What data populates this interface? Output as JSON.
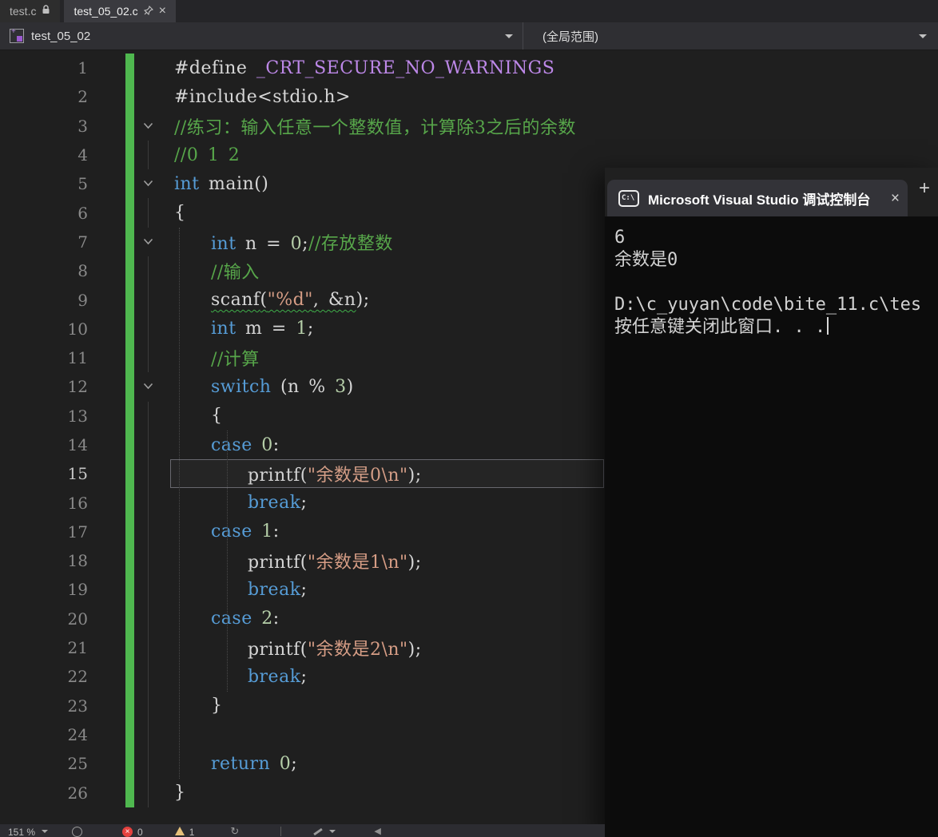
{
  "tabbar": {
    "tabs": [
      {
        "label": "test.c"
      },
      {
        "label": "test_05_02.c"
      }
    ],
    "close_glyph": "×"
  },
  "navbar": {
    "file": "test_05_02",
    "scope": "(全局范围)"
  },
  "editor": {
    "lines": [
      {
        "num": 1,
        "fold": "",
        "tokens": [
          {
            "t": "#define ",
            "c": "pp"
          },
          {
            "t": "_CRT_SECURE_NO_WARNINGS",
            "c": "macro"
          }
        ]
      },
      {
        "num": 2,
        "fold": "",
        "tokens": [
          {
            "t": "#include",
            "c": "pp"
          },
          {
            "t": "<stdio.h>",
            "c": "plain"
          }
        ]
      },
      {
        "num": 3,
        "fold": "v",
        "tokens": [
          {
            "t": "//练习：输入任意一个整数值，计算除3之后的余数",
            "c": "com"
          }
        ]
      },
      {
        "num": 4,
        "fold": "g",
        "tokens": [
          {
            "t": "//0 1 2",
            "c": "com"
          }
        ]
      },
      {
        "num": 5,
        "fold": "v",
        "tokens": [
          {
            "t": "int",
            "c": "kw"
          },
          {
            "t": " main()",
            "c": "plain"
          }
        ]
      },
      {
        "num": 6,
        "fold": "g",
        "tokens": [
          {
            "t": "{",
            "c": "plain"
          }
        ]
      },
      {
        "num": 7,
        "fold": "v",
        "tokens": [
          {
            "t": "    ",
            "c": "plain"
          },
          {
            "t": "int",
            "c": "kw"
          },
          {
            "t": " n = ",
            "c": "plain"
          },
          {
            "t": "0",
            "c": "num"
          },
          {
            "t": ";",
            "c": "plain"
          },
          {
            "t": "//存放整数",
            "c": "com"
          }
        ]
      },
      {
        "num": 8,
        "fold": "g",
        "tokens": [
          {
            "t": "    ",
            "c": "plain"
          },
          {
            "t": "//输入",
            "c": "com"
          }
        ]
      },
      {
        "num": 9,
        "fold": "g",
        "tokens": [
          {
            "t": "    ",
            "c": "plain"
          },
          {
            "t": "scanf",
            "c": "plain sq"
          },
          {
            "t": "(",
            "c": "plain sq"
          },
          {
            "t": "\"%d\"",
            "c": "str sq"
          },
          {
            "t": ", &n",
            "c": "plain sq"
          },
          {
            "t": ");",
            "c": "plain"
          }
        ]
      },
      {
        "num": 10,
        "fold": "g",
        "tokens": [
          {
            "t": "    ",
            "c": "plain"
          },
          {
            "t": "int",
            "c": "kw"
          },
          {
            "t": " m = ",
            "c": "plain"
          },
          {
            "t": "1",
            "c": "num"
          },
          {
            "t": ";",
            "c": "plain"
          }
        ]
      },
      {
        "num": 11,
        "fold": "g",
        "tokens": [
          {
            "t": "    ",
            "c": "plain"
          },
          {
            "t": "//计算",
            "c": "com"
          }
        ]
      },
      {
        "num": 12,
        "fold": "v",
        "tokens": [
          {
            "t": "    ",
            "c": "plain"
          },
          {
            "t": "switch",
            "c": "kw"
          },
          {
            "t": " (n % ",
            "c": "plain"
          },
          {
            "t": "3",
            "c": "num"
          },
          {
            "t": ")",
            "c": "plain"
          }
        ]
      },
      {
        "num": 13,
        "fold": "g",
        "tokens": [
          {
            "t": "    {",
            "c": "plain"
          }
        ]
      },
      {
        "num": 14,
        "fold": "g",
        "tokens": [
          {
            "t": "    ",
            "c": "plain"
          },
          {
            "t": "case",
            "c": "kw"
          },
          {
            "t": " ",
            "c": "plain"
          },
          {
            "t": "0",
            "c": "num"
          },
          {
            "t": ":",
            "c": "plain"
          }
        ]
      },
      {
        "num": 15,
        "fold": "g",
        "hl": true,
        "tokens": [
          {
            "t": "        printf(",
            "c": "plain"
          },
          {
            "t": "\"余数是0\\n\"",
            "c": "str"
          },
          {
            "t": ");",
            "c": "plain"
          }
        ]
      },
      {
        "num": 16,
        "fold": "g",
        "tokens": [
          {
            "t": "        ",
            "c": "plain"
          },
          {
            "t": "break",
            "c": "kw"
          },
          {
            "t": ";",
            "c": "plain"
          }
        ]
      },
      {
        "num": 17,
        "fold": "g",
        "tokens": [
          {
            "t": "    ",
            "c": "plain"
          },
          {
            "t": "case",
            "c": "kw"
          },
          {
            "t": " ",
            "c": "plain"
          },
          {
            "t": "1",
            "c": "num"
          },
          {
            "t": ":",
            "c": "plain"
          }
        ]
      },
      {
        "num": 18,
        "fold": "g",
        "tokens": [
          {
            "t": "        printf(",
            "c": "plain"
          },
          {
            "t": "\"余数是1\\n\"",
            "c": "str"
          },
          {
            "t": ");",
            "c": "plain"
          }
        ]
      },
      {
        "num": 19,
        "fold": "g",
        "tokens": [
          {
            "t": "        ",
            "c": "plain"
          },
          {
            "t": "break",
            "c": "kw"
          },
          {
            "t": ";",
            "c": "plain"
          }
        ]
      },
      {
        "num": 20,
        "fold": "g",
        "tokens": [
          {
            "t": "    ",
            "c": "plain"
          },
          {
            "t": "case",
            "c": "kw"
          },
          {
            "t": " ",
            "c": "plain"
          },
          {
            "t": "2",
            "c": "num"
          },
          {
            "t": ":",
            "c": "plain"
          }
        ]
      },
      {
        "num": 21,
        "fold": "g",
        "tokens": [
          {
            "t": "        printf(",
            "c": "plain"
          },
          {
            "t": "\"余数是2\\n\"",
            "c": "str"
          },
          {
            "t": ");",
            "c": "plain"
          }
        ]
      },
      {
        "num": 22,
        "fold": "g",
        "tokens": [
          {
            "t": "        ",
            "c": "plain"
          },
          {
            "t": "break",
            "c": "kw"
          },
          {
            "t": ";",
            "c": "plain"
          }
        ]
      },
      {
        "num": 23,
        "fold": "g",
        "tokens": [
          {
            "t": "    }",
            "c": "plain"
          }
        ]
      },
      {
        "num": 24,
        "fold": "g",
        "tokens": []
      },
      {
        "num": 25,
        "fold": "g",
        "tokens": [
          {
            "t": "    ",
            "c": "plain"
          },
          {
            "t": "return",
            "c": "kw"
          },
          {
            "t": " ",
            "c": "plain"
          },
          {
            "t": "0",
            "c": "num"
          },
          {
            "t": ";",
            "c": "plain"
          }
        ]
      },
      {
        "num": 26,
        "fold": "g",
        "tokens": [
          {
            "t": "}",
            "c": "plain"
          }
        ]
      }
    ]
  },
  "console": {
    "title": "Microsoft Visual Studio 调试控制台",
    "close_glyph": "×",
    "new_tab_glyph": "+",
    "icon_text": "C:\\",
    "lines": [
      "6",
      "余数是0",
      "",
      "D:\\c_yuyan\\code\\bite_11.c\\tes",
      "按任意键关闭此窗口. . ."
    ]
  },
  "statusbar": {
    "zoom": "151 %",
    "error_count": "0",
    "warning_count": "1",
    "error_glyph": "×",
    "refresh_glyph": "↻",
    "scroll_left_glyph": "◀"
  },
  "colors": {
    "change_bar_green": "#4fb84f",
    "keyword_blue": "#569cd6",
    "comment_green": "#57a64a",
    "string_orange": "#d69d85",
    "number_green": "#b5cea8",
    "macro_purple": "#bd88e8",
    "error_red": "#e5413e",
    "warning_yellow": "#e5c07b"
  }
}
